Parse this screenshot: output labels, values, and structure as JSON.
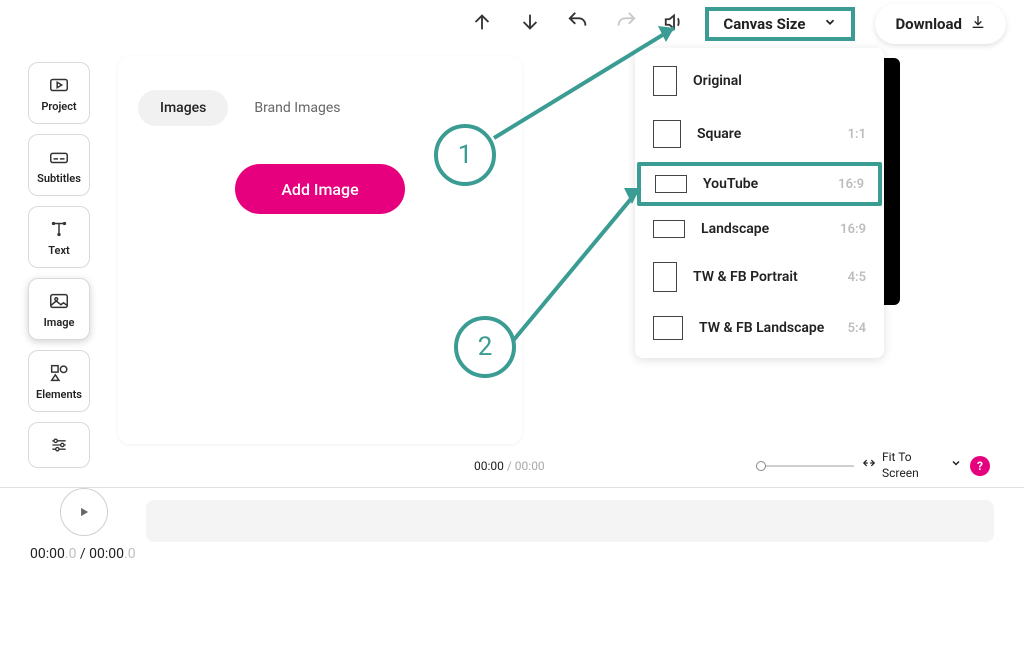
{
  "topbar": {
    "canvas_size_label": "Canvas Size",
    "download_label": "Download"
  },
  "tool_rail": {
    "project": "Project",
    "subtitles": "Subtitles",
    "text": "Text",
    "image": "Image",
    "elements": "Elements"
  },
  "panel": {
    "tab_images": "Images",
    "tab_brand_images": "Brand Images",
    "add_image": "Add Image"
  },
  "canvas_menu": {
    "items": [
      {
        "label": "Original",
        "ratio": ""
      },
      {
        "label": "Square",
        "ratio": "1:1"
      },
      {
        "label": "YouTube",
        "ratio": "16:9"
      },
      {
        "label": "Landscape",
        "ratio": "16:9"
      },
      {
        "label": "TW & FB Portrait",
        "ratio": "4:5"
      },
      {
        "label": "TW & FB Landscape",
        "ratio": "5:4"
      }
    ]
  },
  "callouts": {
    "one": "1",
    "two": "2"
  },
  "transport": {
    "current": "00:00",
    "sep": " / ",
    "total": "00:00",
    "fit_label": "Fit To Screen",
    "help": "?"
  },
  "timeline": {
    "current": "00:00",
    "current_dec": ".0",
    "sep": " / ",
    "total": "00:00",
    "total_dec": ".0"
  }
}
